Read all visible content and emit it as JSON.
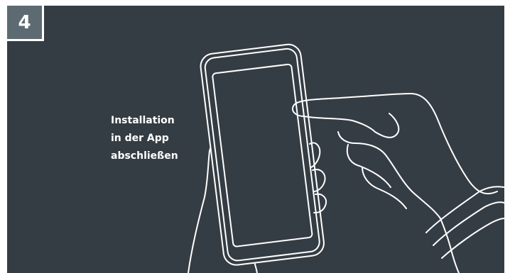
{
  "step": {
    "number": "4"
  },
  "caption": {
    "line1": "Installation",
    "line2": "in der App",
    "line3": "abschließen"
  },
  "colors": {
    "panel_background": "#353d44",
    "badge_background": "#5d6a72",
    "line_art": "#ffffff",
    "text": "#ffffff"
  },
  "illustration": {
    "icon": "hand-holding-smartphone-icon"
  }
}
